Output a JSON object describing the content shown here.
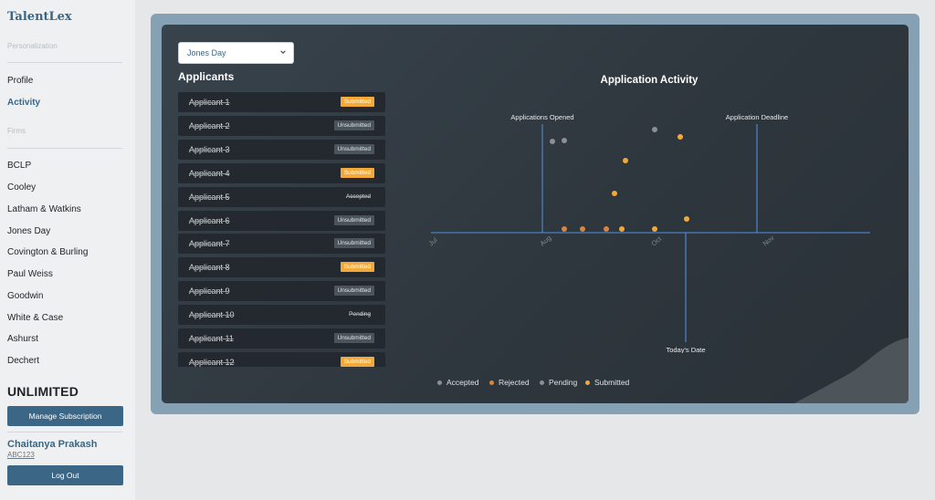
{
  "sidebar": {
    "brand": "TalentLex",
    "personalization_label": "Personalization",
    "personal_items": [
      "Profile",
      "Activity"
    ],
    "firms_label": "Firms",
    "firms": [
      "BCLP",
      "Cooley",
      "Latham & Watkins",
      "Jones Day",
      "Covington & Burling",
      "Paul Weiss",
      "Goodwin",
      "White & Case",
      "Ashurst",
      "Dechert"
    ],
    "plan": "UNLIMITED",
    "manage_button": "Manage Subscription",
    "user_name": "Chaitanya Prakash",
    "user_code": "ABC123",
    "logout_button": "Log Out"
  },
  "main": {
    "firm_selected": "Jones Day",
    "applicants_title": "Applicants",
    "applicants": [
      {
        "name": "Applicant 1",
        "status": "Submitted"
      },
      {
        "name": "Applicant 2",
        "status": "Unsubmitted"
      },
      {
        "name": "Applicant 3",
        "status": "Unsubmitted"
      },
      {
        "name": "Applicant 4",
        "status": "Submitted"
      },
      {
        "name": "Applicant 5",
        "status": "Accepted"
      },
      {
        "name": "Applicant 6",
        "status": "Unsubmitted"
      },
      {
        "name": "Applicant 7",
        "status": "Unsubmitted"
      },
      {
        "name": "Applicant 8",
        "status": "Submitted"
      },
      {
        "name": "Applicant 9",
        "status": "Unsubmitted"
      },
      {
        "name": "Applicant 10",
        "status": "Pending"
      },
      {
        "name": "Applicant 11",
        "status": "Unsubmitted"
      },
      {
        "name": "Applicant 12",
        "status": "Submitted"
      }
    ]
  },
  "colors": {
    "accent": "#3b6685",
    "submitted": "#f3a93a",
    "rejected": "#d9853f",
    "accepted": "#8b9095",
    "pending": "#8b9095",
    "marker_line": "#4a7fc1"
  },
  "chart_data": {
    "type": "scatter",
    "title": "Application Activity",
    "x_ticks": [
      "Jul",
      "Aug",
      "Oct",
      "Nov"
    ],
    "markers": [
      {
        "label": "Applications Opened",
        "at": "Aug"
      },
      {
        "label": "Application Deadline",
        "at": "Nov"
      },
      {
        "label": "Today's Date",
        "at": "Oct+"
      }
    ],
    "legend": [
      "Accepted",
      "Rejected",
      "Pending",
      "Submitted"
    ],
    "legend_position": "bottom"
  }
}
